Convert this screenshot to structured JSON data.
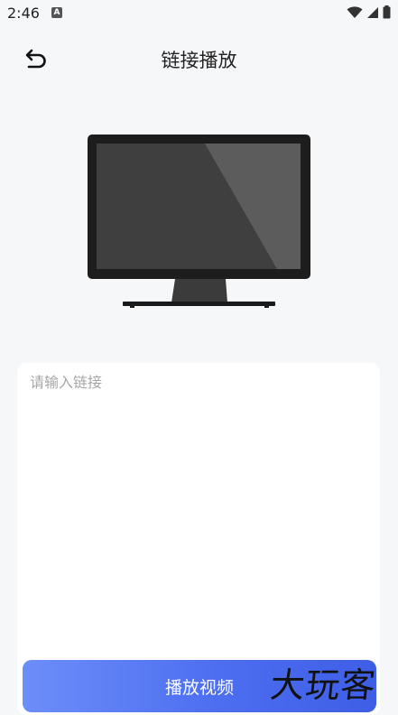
{
  "status_bar": {
    "time": "2:46",
    "badge": "A",
    "icons": [
      "wifi-icon",
      "signal-icon",
      "battery-icon"
    ]
  },
  "header": {
    "title": "链接播放",
    "back_icon": "undo-arrow-icon"
  },
  "monitor_illustration": {
    "icon": "monitor-icon"
  },
  "link_card": {
    "input_value": "",
    "input_placeholder": "请输入链接"
  },
  "play_button": {
    "label": "播放视频"
  },
  "watermark": {
    "text": "大玩客"
  },
  "colors": {
    "background": "#f6f7f9",
    "button_gradient_start": "#6c8ef8",
    "button_gradient_end": "#3e5ee6",
    "placeholder": "#a6a6a6"
  }
}
